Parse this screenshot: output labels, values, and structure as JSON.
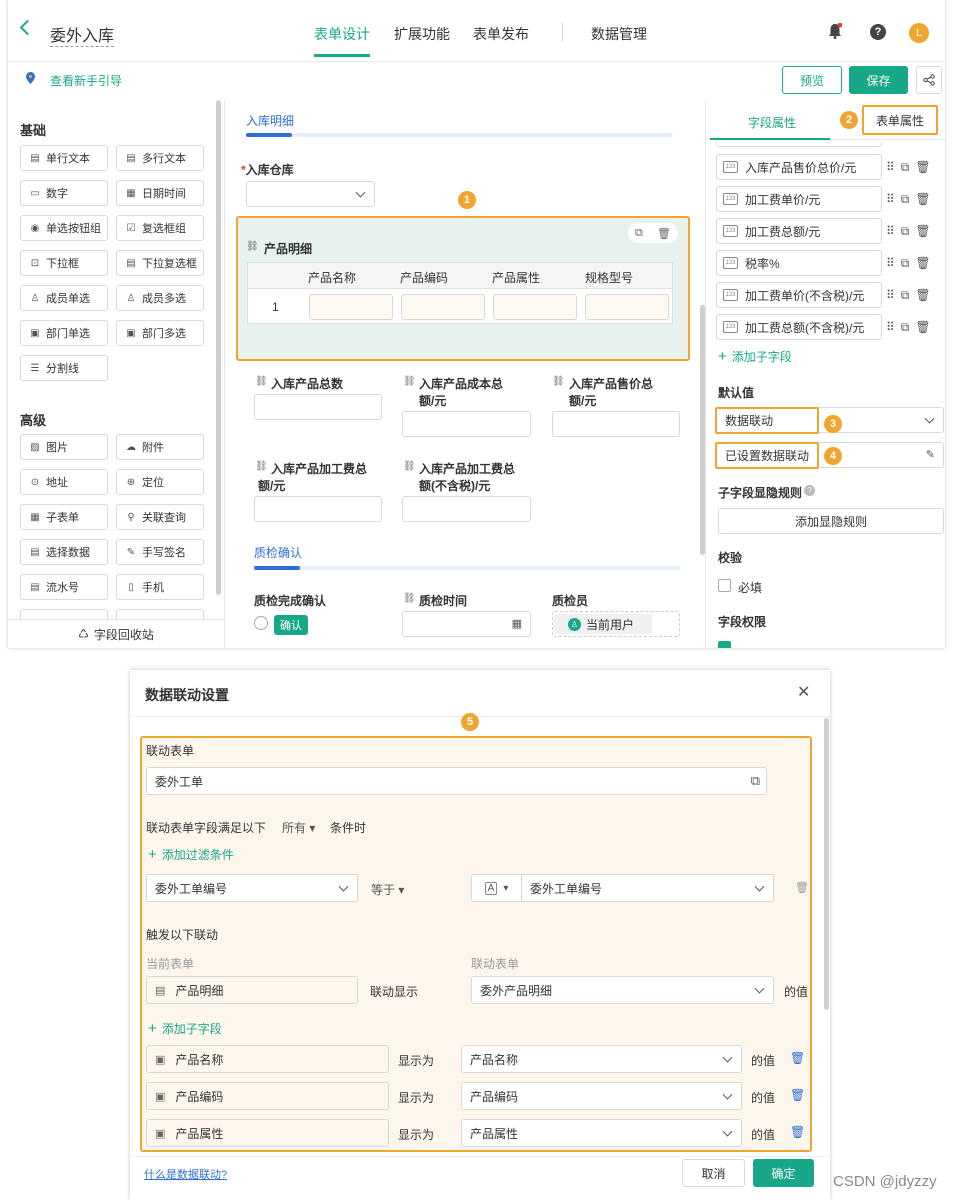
{
  "header": {
    "title": "委外入库",
    "tabs": [
      "表单设计",
      "扩展功能",
      "表单发布",
      "数据管理"
    ],
    "avatar": "L"
  },
  "subbar": {
    "guide": "查看新手引导",
    "preview": "预览",
    "save": "保存"
  },
  "widgets": {
    "basic_title": "基础",
    "basic": [
      "单行文本",
      "多行文本",
      "数字",
      "日期时间",
      "单选按钮组",
      "复选框组",
      "下拉框",
      "下拉复选框",
      "成员单选",
      "成员多选",
      "部门单选",
      "部门多选",
      "分割线"
    ],
    "advanced_title": "高级",
    "advanced": [
      "图片",
      "附件",
      "地址",
      "定位",
      "子表单",
      "关联查询",
      "选择数据",
      "手写签名",
      "流水号",
      "手机"
    ],
    "recycle": "字段回收站"
  },
  "canvas": {
    "section1": "入库明细",
    "warehouse_label": "入库仓库",
    "subform_title": "产品明细",
    "subform_columns": [
      "产品名称",
      "产品编码",
      "产品属性",
      "规格型号"
    ],
    "subform_row_num": "1",
    "fields": [
      "入库产品总数",
      "入库产品成本总额/元",
      "入库产品售价总额/元",
      "入库产品加工费总额/元",
      "入库产品加工费总额(不含税)/元"
    ],
    "field_lines": [
      [
        "入库产品总数",
        ""
      ],
      [
        "入库产品成本总",
        "额/元"
      ],
      [
        "入库产品售价总",
        "额/元"
      ],
      [
        "入库产品加工费总",
        "额/元"
      ],
      [
        "入库产品加工费总",
        "额(不含税)/元"
      ]
    ],
    "section2": "质检确认",
    "qc_confirm_label": "质检完成确认",
    "qc_confirm_btn": "确认",
    "qc_time_label": "质检时间",
    "qc_person_label": "质检员",
    "qc_person_value": "当前用户"
  },
  "rightpanel": {
    "tab_field": "字段属性",
    "tab_form": "表单属性",
    "subfields": [
      "入库产品售价总价/元",
      "加工费单价/元",
      "加工费总额/元",
      "税率%",
      "加工费单价(不含税)/元",
      "加工费总额(不含税)/元"
    ],
    "add_subfield": "添加子字段",
    "default_title": "默认值",
    "default_value": "数据联动",
    "linkage_set": "已设置数据联动",
    "visibility_title": "子字段显隐规则",
    "add_rule": "添加显隐规则",
    "validate_title": "校验",
    "required": "必填",
    "perm_title": "字段权限"
  },
  "markers": [
    "1",
    "2",
    "3",
    "4",
    "5"
  ],
  "dialog": {
    "title": "数据联动设置",
    "link_form_label": "联动表单",
    "link_form_value": "委外工单",
    "cond_prefix": "联动表单字段满足以下",
    "cond_mode": "所有",
    "cond_suffix": "条件时",
    "add_filter": "添加过滤条件",
    "filter_field": "委外工单编号",
    "filter_op": "等于",
    "filter_type": "A",
    "filter_value": "委外工单编号",
    "trigger_label": "触发以下联动",
    "current_form": "当前表单",
    "linked_form": "联动表单",
    "current_sub": "产品明细",
    "show_label": "联动显示",
    "linked_sub": "委外产品明细",
    "value_of": "的值",
    "add_sub": "添加子字段",
    "mappings": [
      {
        "field": "产品名称",
        "show": "显示为",
        "target": "产品名称",
        "of": "的值"
      },
      {
        "field": "产品编码",
        "show": "显示为",
        "target": "产品编码",
        "of": "的值"
      },
      {
        "field": "产品属性",
        "show": "显示为",
        "target": "产品属性",
        "of": "的值"
      }
    ],
    "help_link": "什么是数据联动?",
    "cancel": "取消",
    "ok": "确定"
  },
  "watermark": "CSDN @jdyzzy",
  "colors": {
    "accent": "#17a889",
    "highlight": "#f0a530",
    "blue": "#2e6fd6"
  }
}
